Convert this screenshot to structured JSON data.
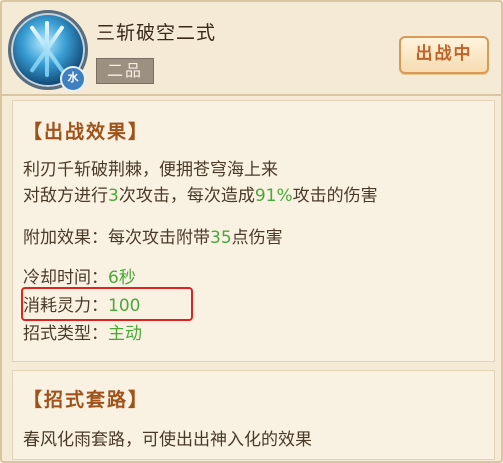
{
  "skill": {
    "name": "三斩破空二式",
    "grade": "二品",
    "element": "水",
    "status": "出战中"
  },
  "effect_section": {
    "title": "【出战效果】",
    "desc_line1": "利刃千斩破荆棘，便拥苍穹海上来",
    "desc_line2": {
      "a": "对敌方进行",
      "b": "3",
      "c": "次攻击，每次造成",
      "d": "91%",
      "e": "攻击的伤害"
    },
    "extra": {
      "label": "附加效果：每次攻击附带",
      "value": "35",
      "suffix": "点伤害"
    },
    "cooldown": {
      "label": "冷却时间：",
      "value": "6秒"
    },
    "cost": {
      "label": "消耗灵力：",
      "value": "100"
    },
    "type": {
      "label": "招式类型：",
      "value": "主动"
    }
  },
  "routine_section": {
    "title": "【招式套路】",
    "desc": "春风化雨套路，可使出出神入化的效果"
  },
  "colors": {
    "highlight": "#4aa83a",
    "title": "#a0521a",
    "callout": "#e0231f"
  }
}
